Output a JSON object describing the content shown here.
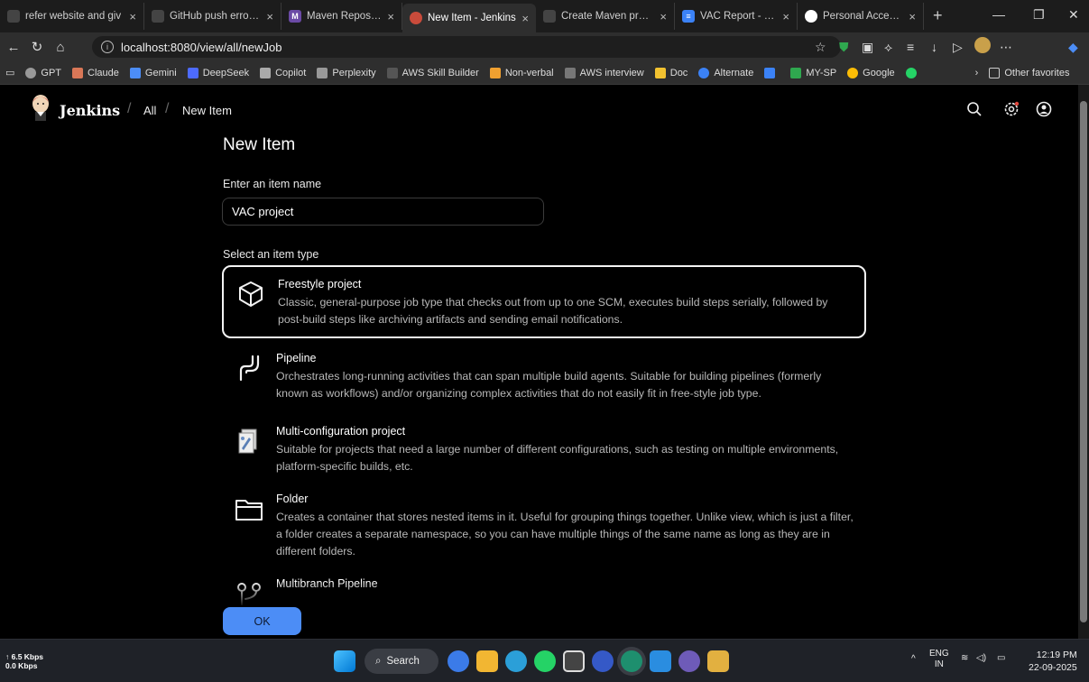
{
  "browser": {
    "tabs": [
      {
        "label": "refer website and giv",
        "fav_color": "#444"
      },
      {
        "label": "GitHub push error fix",
        "fav_color": "#444"
      },
      {
        "label": "Maven Repository: o",
        "fav_color": "#6b4aa5"
      },
      {
        "label": "New Item - Jenkins",
        "fav_color": "#c94b3b",
        "active": true
      },
      {
        "label": "Create Maven projec",
        "fav_color": "#444"
      },
      {
        "label": "VAC Report - Google",
        "fav_color": "#3b82f6"
      },
      {
        "label": "Personal Access Toke",
        "fav_color": "#fff"
      }
    ],
    "url": "localhost:8080/view/all/newJob",
    "bookmarks": [
      {
        "label": "GPT",
        "color": "#999"
      },
      {
        "label": "Claude",
        "color": "#d97757"
      },
      {
        "label": "Gemini",
        "color": "#4c8df6"
      },
      {
        "label": "DeepSeek",
        "color": "#4d6bfe"
      },
      {
        "label": "Copilot",
        "color": "#aaa"
      },
      {
        "label": "Perplexity",
        "color": "#999"
      },
      {
        "label": "AWS Skill Builder",
        "color": "#555"
      },
      {
        "label": "Non-verbal",
        "color": "#f0a030"
      },
      {
        "label": "AWS interview",
        "color": "#777"
      },
      {
        "label": "Doc",
        "color": "#f2c230"
      },
      {
        "label": "Alternate",
        "color": "#3b82f6"
      },
      {
        "label": "",
        "color": "#3b82f6"
      },
      {
        "label": "MY-SP",
        "color": "#2fa84f"
      },
      {
        "label": "Google",
        "color": "#fbbc05"
      },
      {
        "label": "",
        "color": "#25d366"
      }
    ],
    "other_favorites": "Other favorites"
  },
  "jenkins": {
    "brand": "Jenkins",
    "breadcrumbs": [
      "All",
      "New Item"
    ],
    "page_title": "New Item",
    "name_label": "Enter an item name",
    "name_value": "VAC project",
    "type_label": "Select an item type",
    "item_types": [
      {
        "name": "Freestyle project",
        "icon": "cube-icon",
        "selected": true,
        "description": "Classic, general-purpose job type that checks out from up to one SCM, executes build steps serially, followed by post-build steps like archiving artifacts and sending email notifications."
      },
      {
        "name": "Pipeline",
        "icon": "pipeline-icon",
        "description": "Orchestrates long-running activities that can span multiple build agents. Suitable for building pipelines (formerly known as workflows) and/or organizing complex activities that do not easily fit in free-style job type."
      },
      {
        "name": "Multi-configuration project",
        "icon": "multi-config-icon",
        "description": "Suitable for projects that need a large number of different configurations, such as testing on multiple environments, platform-specific builds, etc."
      },
      {
        "name": "Folder",
        "icon": "folder-icon",
        "description": "Creates a container that stores nested items in it. Useful for grouping things together. Unlike view, which is just a filter, a folder creates a separate namespace, so you can have multiple things of the same name as long as they are in different folders."
      },
      {
        "name": "Multibranch Pipeline",
        "icon": "branch-icon",
        "description": ""
      }
    ],
    "ok_label": "OK"
  },
  "taskbar": {
    "net_up": "↑ 6.5 Kbps",
    "net_down": "0.0 Kbps",
    "search_label": "Search",
    "lang": "ENG",
    "region": "IN",
    "time": "12:19 PM",
    "date": "22-09-2025"
  }
}
